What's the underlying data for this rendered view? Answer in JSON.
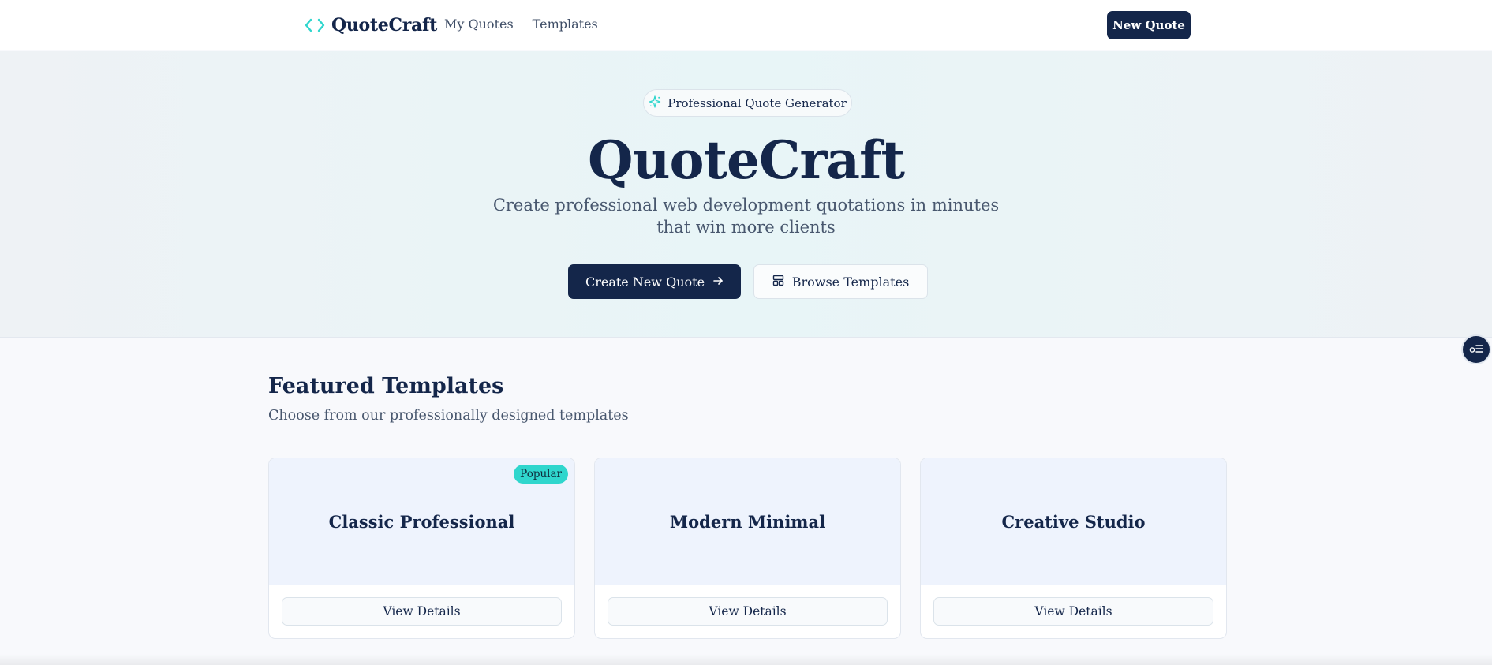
{
  "header": {
    "brand": "QuoteCraft",
    "nav": [
      "My Quotes",
      "Templates"
    ],
    "new_quote": "New Quote"
  },
  "hero": {
    "badge": "Professional Quote Generator",
    "title": "QuoteCraft",
    "subtitle": "Create professional web development quotations in minutes that win more clients",
    "primary_cta": "Create New Quote",
    "secondary_cta": "Browse Templates"
  },
  "featured": {
    "title": "Featured Templates",
    "subtitle": "Choose from our professionally designed templates",
    "cards": [
      {
        "title": "Classic Professional",
        "badge": "Popular",
        "button": "View Details"
      },
      {
        "title": "Modern Minimal",
        "button": "View Details"
      },
      {
        "title": "Creative Studio",
        "button": "View Details"
      }
    ]
  },
  "colors": {
    "navy": "#14264a",
    "teal": "#2fd6cd",
    "card_preview": "#eef3fd"
  },
  "icons": {
    "brand": "code-brackets-icon",
    "badge": "sparkle-icon",
    "primary_cta": "arrow-right-icon",
    "secondary_cta": "layout-template-icon",
    "floating": "list-settings-icon"
  }
}
